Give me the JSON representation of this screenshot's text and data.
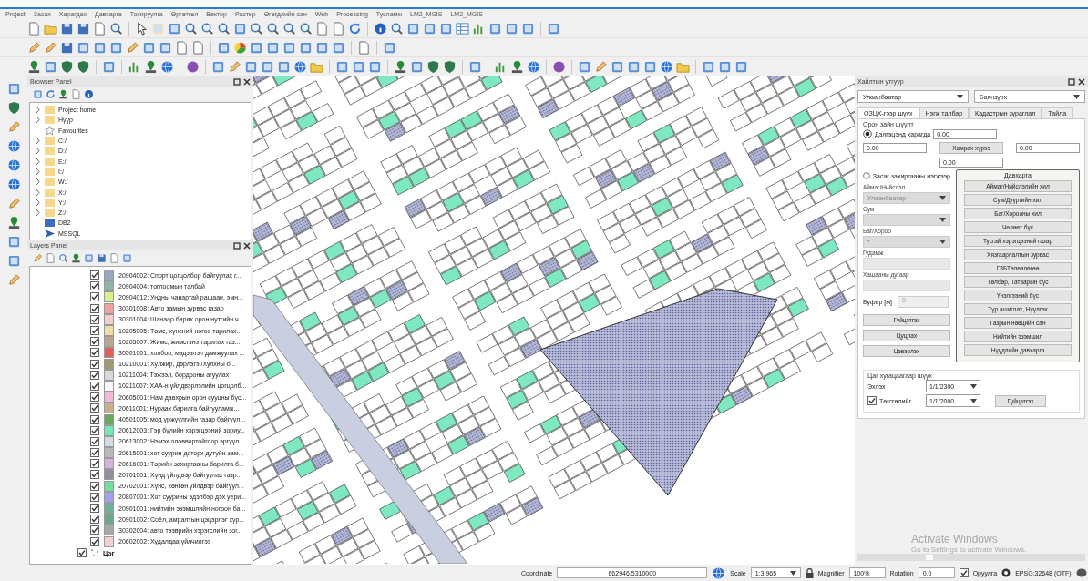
{
  "menu_bar": [
    "Project",
    "Засах",
    "Харагдах",
    "Давхарга",
    "Тохируулга",
    "Өргөтгөл",
    "Вектор",
    "Растер",
    "Өгөгдлийн сан",
    "Web",
    "Processing",
    "Тусламж",
    "LM2_MGIS",
    "LM2_MGIS"
  ],
  "browser_panel": {
    "title": "Browser Panel",
    "items": [
      {
        "label": "Project home",
        "kind": "folder"
      },
      {
        "label": "Нүүр",
        "kind": "folder"
      },
      {
        "label": "Favourites",
        "kind": "favourites"
      },
      {
        "label": "C:/",
        "kind": "folder"
      },
      {
        "label": "D:/",
        "kind": "folder"
      },
      {
        "label": "E:/",
        "kind": "folder"
      },
      {
        "label": "I:/",
        "kind": "folder"
      },
      {
        "label": "W:/",
        "kind": "folder"
      },
      {
        "label": "X:/",
        "kind": "folder"
      },
      {
        "label": "Y:/",
        "kind": "folder"
      },
      {
        "label": "Z:/",
        "kind": "folder"
      },
      {
        "label": "DB2",
        "kind": "database"
      },
      {
        "label": "MSSQL",
        "kind": "server"
      }
    ]
  },
  "layers_panel": {
    "title": "Layers Panel",
    "layers": [
      {
        "label": "20904002: Спорт цогцолбор байгуулах г...",
        "color": "#9aa6c0",
        "checked": true
      },
      {
        "label": "20904004: тоглоомын талбай",
        "color": "#8fb3a8",
        "checked": true
      },
      {
        "label": "20904012: Ундны чанартай рашаан, эмн...",
        "color": "#d6f08a",
        "checked": true
      },
      {
        "label": "30301008: Авто замын зурвас газар",
        "color": "#f4a0a0",
        "checked": true
      },
      {
        "label": "30301004: Шанаар барих орон нутгийн ч...",
        "color": "#f2d0d0",
        "checked": true
      },
      {
        "label": "10205005: Төмс, хүнсний ногоо тарилах...",
        "color": "#f2dca8",
        "checked": true
      },
      {
        "label": "10205007: Жимс, жимсгэнэ тарилах газ...",
        "color": "#b9a890",
        "checked": true
      },
      {
        "label": "30501001: холбоо, мэдээлэл дамжуулах ...",
        "color": "#e06060",
        "checked": true
      },
      {
        "label": "10210001: Хулжир, дэрлэгэ /Хулхны б...",
        "color": "#a09870",
        "checked": true
      },
      {
        "label": "10211004: Тэжээл, бордооны агуулах",
        "color": "#d8d8d8",
        "checked": true
      },
      {
        "label": "10211007: ХАА-н үйлдвэрлэлийн цогцолб...",
        "color": "#f8f8f8",
        "checked": true
      },
      {
        "label": "20605001: Нам давхрын орон сууцны бүс...",
        "color": "#f4b8d8",
        "checked": true
      },
      {
        "label": "20611001: Нураах барилга байгууламж...",
        "color": "#c8b090",
        "checked": true
      },
      {
        "label": "40501005: мод үржүүлгийн газар байгуул...",
        "color": "#6aa860",
        "checked": true
      },
      {
        "label": "20612003: Гэр бүлийн хэрэгцээний зориу...",
        "color": "#70e8b8",
        "checked": true
      },
      {
        "label": "20613002: Нэмэх оловвортойгоор эргүүл...",
        "color": "#d0dce0",
        "checked": true
      },
      {
        "label": "20615001: хот суурин доторх дутуйн зам...",
        "color": "#b8b8b8",
        "checked": true
      },
      {
        "label": "20616001: Төрийн захиргааны барилга б...",
        "color": "#d8b0e0",
        "checked": true
      },
      {
        "label": "20701001: Хүнд үйлдвэр байгуулах газр...",
        "color": "#909098",
        "checked": true
      },
      {
        "label": "20702001: Хүнс, хөнгөн үйлдвэр байгуул...",
        "color": "#70e0a0",
        "checked": true
      },
      {
        "label": "20807001: Хот суурины эдэлбэр дэх уери...",
        "color": "#a0a0f8",
        "checked": true
      },
      {
        "label": "20901001: нийтийн эзэмшлийн ногоон ба...",
        "color": "#70b098",
        "checked": true
      },
      {
        "label": "20901002: Соёл, амралтын цэцэрлэг хүр...",
        "color": "#68a888",
        "checked": true
      },
      {
        "label": "30302004: авто тээврийн хэрэгслийн зог...",
        "color": "#a8a8a8",
        "checked": true
      },
      {
        "label": "20602002: Худалдаа үйлчилгээ",
        "color": "#f0d0d0",
        "checked": true
      }
    ],
    "group": {
      "label": "Цэг",
      "checked": true
    }
  },
  "search_panel": {
    "title": "Хайлтын утгуур",
    "city_select": "Улаанбаатар",
    "district_select": "Баянзүрх",
    "tabs": [
      {
        "label": "ОЗЦХ-гээр шүүх",
        "selected": true
      },
      {
        "label": "Нэгж талбар",
        "selected": false
      },
      {
        "label": "Кадастрын зураглал",
        "selected": false
      },
      {
        "label": "Тайла",
        "selected": false
      }
    ],
    "spatial_filter": {
      "title": "Орон зайн шүүлт",
      "screen_radio": {
        "label": "Дэлгэцэнд харагда",
        "selected": true
      },
      "top_field": "0.00",
      "left_field": "0.00",
      "extent_button": "Хамрах хүрээ",
      "right_field": "0.00",
      "bottom_field": "0.00"
    },
    "admin_filter": {
      "radio": {
        "label": "Засаг захиргааны нэгжээр",
        "selected": false
      },
      "aimag_label": "Аймаг/Нийслэл",
      "aimag_value": "Улаанбаатар",
      "sum_label": "Сум",
      "bag_label": "Баг/Хороо",
      "bag_value": "*",
      "street_label": "Гудамж",
      "fence_label": "Хашааны дугаар",
      "buffer_label": "Буфер [м]",
      "buffer_value": "0"
    },
    "action_buttons": [
      "Гүйцэтгэх",
      "Цуцлах",
      "Цэвэрлэх"
    ],
    "layers_group": {
      "title": "Давхарга",
      "buttons": [
        "Аймаг/Нийслэлийн хил",
        "Сум/Дүүргийн хил",
        "Баг/Хорооны хил",
        "Чөлөөт бүс",
        "Тусгай хэрэгцээний газар",
        "Хязгаарлалтын зурвас",
        "ГЗБТөлөвлөгөө",
        "Төлбөр, Татварын бүс",
        "Үнэлгээний бүс",
        "Түр ашиглах, Нүүлгэх",
        "Газрын нөөцийн сан",
        "Нийтийн эзэмшил",
        "Нүүдлийн давхарга"
      ]
    },
    "time_filter": {
      "title": "Цаг хугацаагаар шүүх",
      "start_label": "Эхлэх",
      "start_value": "1/1/2300",
      "end_label": "Төгсгөлийг",
      "end_checked": true,
      "end_value": "1/1/2000",
      "run_button": "Гүйцэтгэх"
    }
  },
  "windows_notice": {
    "title": "Activate Windows",
    "subtitle": "Go to Settings to activate Windows."
  },
  "status_bar": {
    "coordinate_label": "Coordinate",
    "coordinate_value": "662946,5310000",
    "scale_label": "Scale",
    "scale_value": "1:3,965",
    "magnifier_label": "Magnifier",
    "magnifier_value": "100%",
    "rotation_label": "Rotation",
    "rotation_value": "0.0",
    "render_label": "Оруулга",
    "render_checked": true,
    "crs": "EPSG:32648 (OTF)"
  }
}
